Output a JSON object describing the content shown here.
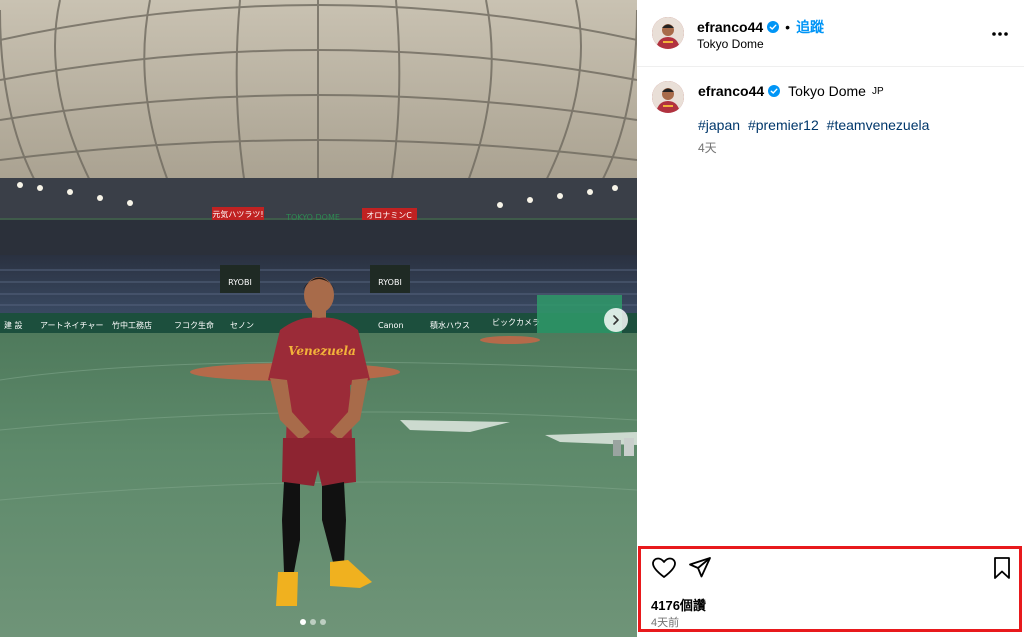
{
  "post": {
    "username": "efranco44",
    "verified": true,
    "follow_label": "追蹤",
    "separator": "•",
    "location": "Tokyo Dome",
    "location_suffix": "JP",
    "hashtags": [
      "#japan",
      "#premier12",
      "#teamvenezuela"
    ],
    "caption_time": "4天",
    "likes": "4176個讚",
    "time_ago": "4天前"
  },
  "media": {
    "carousel_slide_count": 3,
    "active_slide": 1,
    "jersey_text": "Venezuela",
    "signage": [
      "元気ハツラツ!",
      "オロナミンC",
      "TOKYO DOME",
      "RYOBI",
      "RYOBI",
      "建 設",
      "アートネイチャー",
      "竹中工務店",
      "フコク生命",
      "セノン",
      "Canon",
      "積水ハウス",
      "ビックカメラ"
    ]
  },
  "icons": {
    "more": "more-horizontal-icon",
    "like": "heart-icon",
    "share": "paper-plane-icon",
    "save": "bookmark-icon",
    "verified": "verified-badge-icon",
    "next": "chevron-right-icon"
  },
  "colors": {
    "link_blue": "#0095f6",
    "hashtag": "#00376b",
    "muted": "#737373",
    "highlight_box": "#e8191c",
    "verified": "#0095f6"
  }
}
